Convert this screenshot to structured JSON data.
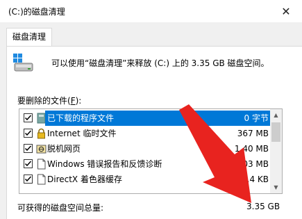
{
  "window": {
    "title": "(C:)的磁盘清理",
    "close_glyph": "✕"
  },
  "tabs": [
    {
      "label": "磁盘清理"
    }
  ],
  "info": {
    "text": "可以使用“磁盘清理”来释放  (C:) 上的 3.35 GB 磁盘空间。"
  },
  "files_section": {
    "label_prefix": "要删除的文件(",
    "label_accel": "F",
    "label_suffix": "):"
  },
  "files": [
    {
      "name": "已下载的程序文件",
      "size": "0 字节",
      "checked": true,
      "selected": true,
      "icon": "program-file-icon"
    },
    {
      "name": "Internet 临时文件",
      "size": "367 MB",
      "checked": true,
      "selected": false,
      "icon": "lock-icon"
    },
    {
      "name": "脱机网页",
      "size": "1.40 MB",
      "checked": true,
      "selected": false,
      "icon": "offline-page-icon"
    },
    {
      "name": "Windows 错误报告和反馈诊断",
      "size": "1.03 MB",
      "checked": true,
      "selected": false,
      "icon": "document-icon"
    },
    {
      "name": "DirectX 着色器缓存",
      "size": "66.4 KB",
      "checked": true,
      "selected": false,
      "icon": "document-icon"
    }
  ],
  "total": {
    "label": "可获得的磁盘空间总量:",
    "value": "3.35 GB"
  },
  "colors": {
    "selection": "#0078d7",
    "arrow": "#e8231f"
  }
}
